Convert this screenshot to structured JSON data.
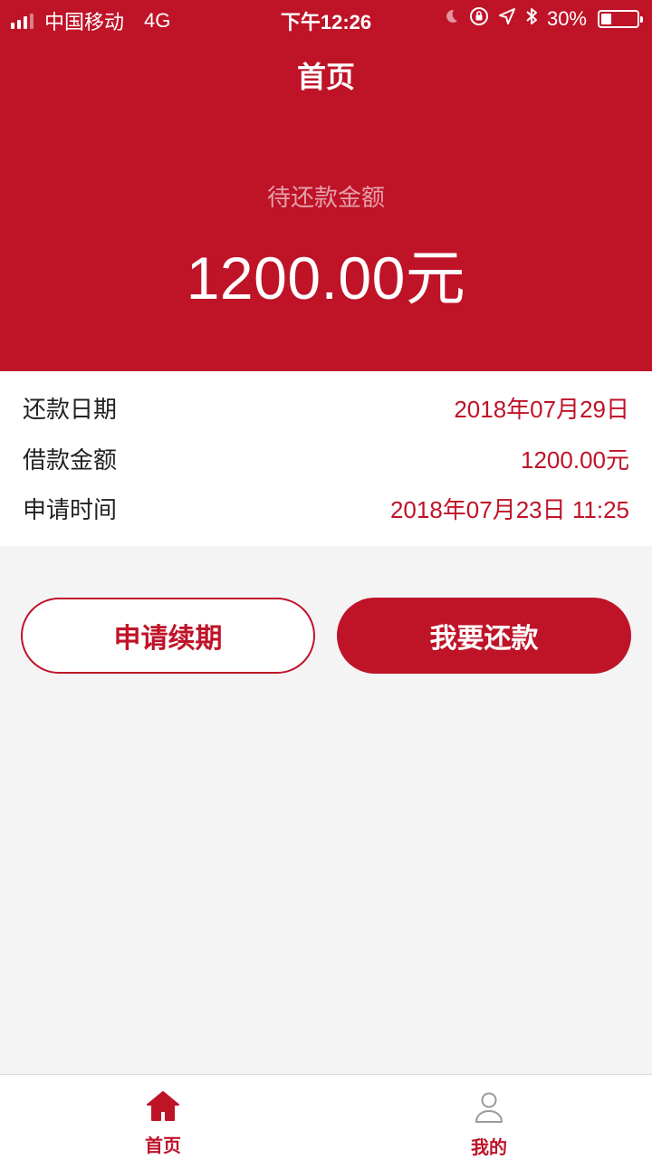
{
  "status_bar": {
    "carrier": "中国移动",
    "network": "4G",
    "time": "下午12:26",
    "battery_text": "30%",
    "battery_level": 0.3,
    "icons": [
      "moon-icon",
      "orientation-lock-icon",
      "location-icon",
      "bluetooth-icon"
    ]
  },
  "header": {
    "title": "首页"
  },
  "summary": {
    "label": "待还款金额",
    "amount": "1200.00元"
  },
  "details": [
    {
      "label": "还款日期",
      "value": "2018年07月29日"
    },
    {
      "label": "借款金额",
      "value": "1200.00元"
    },
    {
      "label": "申请时间",
      "value": "2018年07月23日 11:25"
    }
  ],
  "actions": {
    "renew": "申请续期",
    "repay": "我要还款"
  },
  "tabs": [
    {
      "label": "首页",
      "icon": "home-icon",
      "active": true
    },
    {
      "label": "我的",
      "icon": "user-icon",
      "active": false
    }
  ],
  "colors": {
    "brand": "#bf1328",
    "background": "#f4f4f4"
  }
}
